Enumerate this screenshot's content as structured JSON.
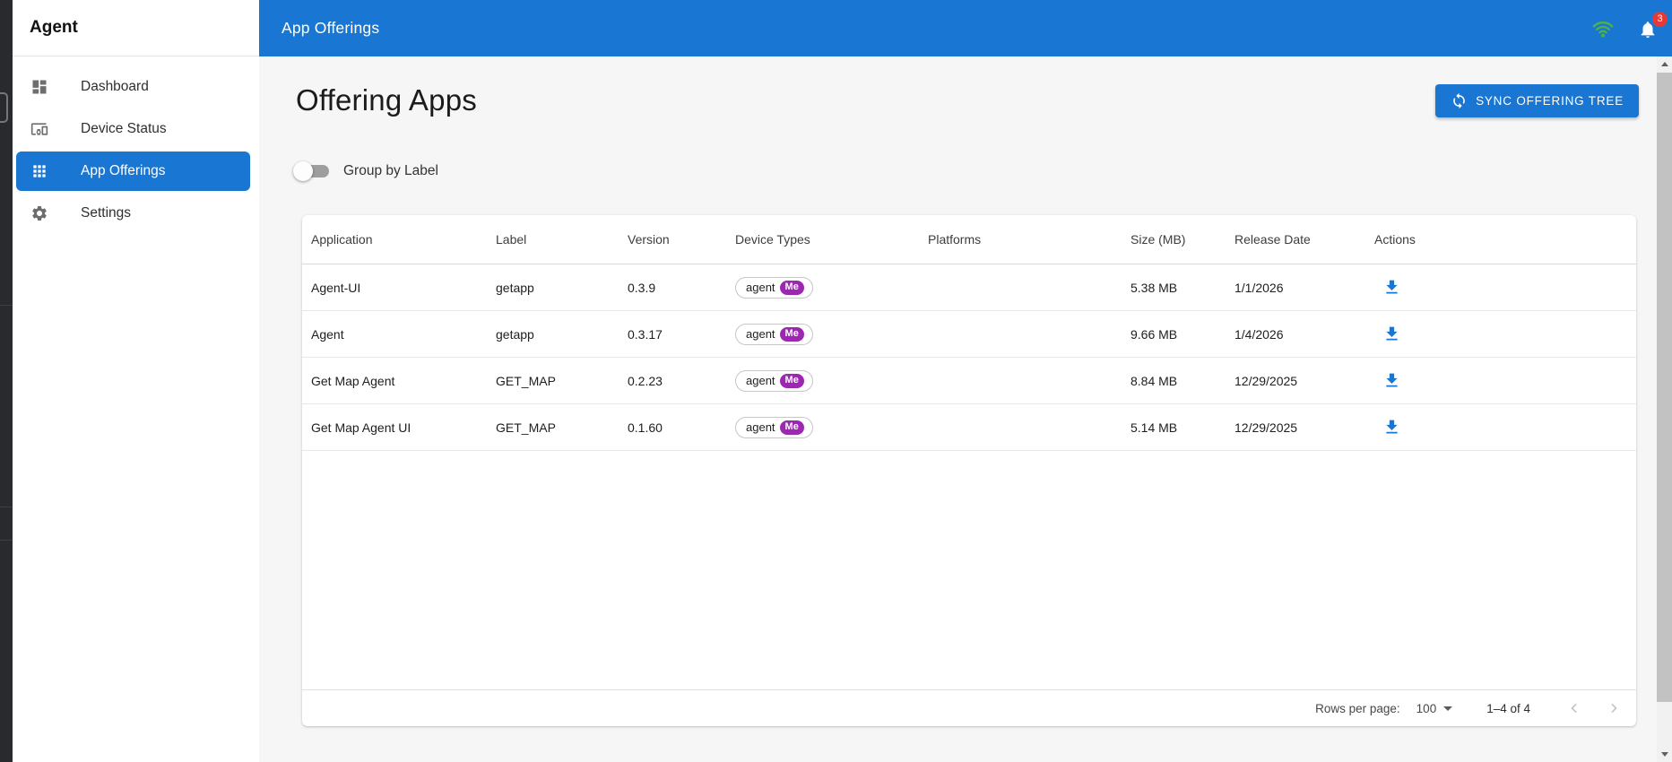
{
  "sidebar": {
    "title": "Agent",
    "items": [
      {
        "label": "Dashboard",
        "icon": "dashboard-icon",
        "selected": false
      },
      {
        "label": "Device Status",
        "icon": "devices-icon",
        "selected": false
      },
      {
        "label": "App Offerings",
        "icon": "apps-grid-icon",
        "selected": true
      },
      {
        "label": "Settings",
        "icon": "gear-icon",
        "selected": false
      }
    ]
  },
  "appbar": {
    "title": "App Offerings",
    "wifi_icon": "wifi-icon",
    "bell_icon": "bell-icon",
    "notification_count": "3"
  },
  "page": {
    "title": "Offering Apps",
    "sync_button_label": "SYNC OFFERING TREE",
    "group_toggle_label": "Group by Label",
    "group_toggle_on": false
  },
  "table": {
    "headers": [
      "Application",
      "Label",
      "Version",
      "Device Types",
      "Platforms",
      "Size (MB)",
      "Release Date",
      "Actions"
    ],
    "rows": [
      {
        "application": "Agent-UI",
        "label": "getapp",
        "version": "0.3.9",
        "device_types": [
          {
            "name": "agent",
            "badge": "Me"
          }
        ],
        "platforms": "",
        "size": "5.38 MB",
        "release_date": "1/1/2026"
      },
      {
        "application": "Agent",
        "label": "getapp",
        "version": "0.3.17",
        "device_types": [
          {
            "name": "agent",
            "badge": "Me"
          }
        ],
        "platforms": "",
        "size": "9.66 MB",
        "release_date": "1/4/2026"
      },
      {
        "application": "Get Map Agent",
        "label": "GET_MAP",
        "version": "0.2.23",
        "device_types": [
          {
            "name": "agent",
            "badge": "Me"
          }
        ],
        "platforms": "",
        "size": "8.84 MB",
        "release_date": "12/29/2025"
      },
      {
        "application": "Get Map Agent UI",
        "label": "GET_MAP",
        "version": "0.1.60",
        "device_types": [
          {
            "name": "agent",
            "badge": "Me"
          }
        ],
        "platforms": "",
        "size": "5.14 MB",
        "release_date": "12/29/2025"
      }
    ]
  },
  "pagination": {
    "rows_per_page_label": "Rows per page:",
    "rows_per_page_value": "100",
    "range": "1–4 of 4"
  },
  "colors": {
    "primary_blue": "#1976d2",
    "badge_purple": "#9c27b0",
    "wifi_green": "#4caf50",
    "alert_red": "#e53935",
    "strip_dark": "#282a2e"
  }
}
